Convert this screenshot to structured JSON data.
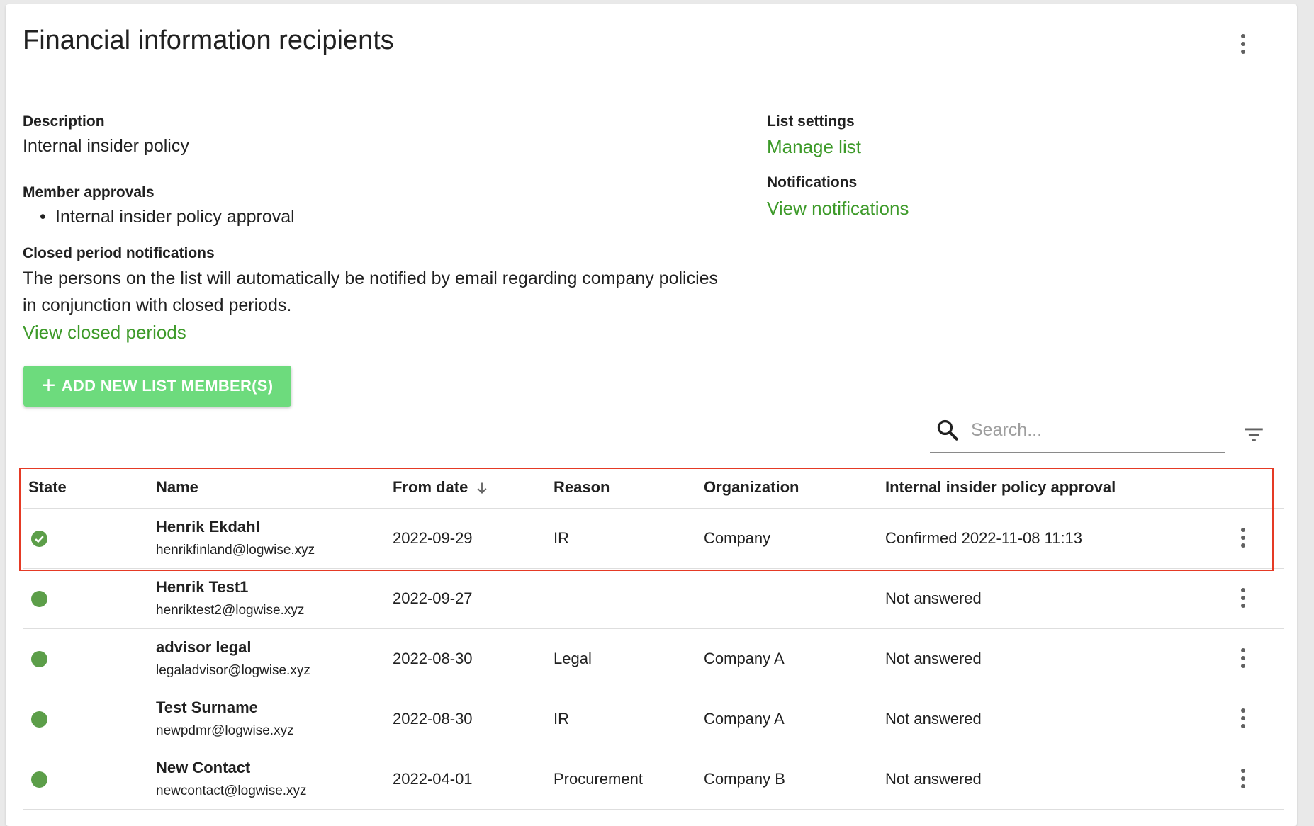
{
  "page": {
    "title": "Financial information recipients"
  },
  "details": {
    "description_label": "Description",
    "description_value": "Internal insider policy",
    "member_approvals_label": "Member approvals",
    "member_approvals": [
      "Internal insider policy approval"
    ],
    "closed_period_label": "Closed period notifications",
    "closed_period_text": "The persons on the list will automatically be notified by email regarding company policies in conjunction with closed periods.",
    "view_closed_periods": "View closed periods",
    "list_settings_label": "List settings",
    "manage_list": "Manage list",
    "notifications_label": "Notifications",
    "view_notifications": "View notifications"
  },
  "actions": {
    "add_member_label": "ADD NEW LIST MEMBER(S)"
  },
  "search": {
    "placeholder": "Search..."
  },
  "table": {
    "headers": {
      "state": "State",
      "name": "Name",
      "from_date": "From date",
      "reason": "Reason",
      "organization": "Organization",
      "approval": "Internal insider policy approval"
    },
    "rows": [
      {
        "state": "confirmed",
        "name": "Henrik Ekdahl",
        "email": "henrikfinland@logwise.xyz",
        "from_date": "2022-09-29",
        "reason": "IR",
        "organization": "Company",
        "approval": "Confirmed 2022-11-08 11:13"
      },
      {
        "state": "active",
        "name": "Henrik Test1",
        "email": "henriktest2@logwise.xyz",
        "from_date": "2022-09-27",
        "reason": "",
        "organization": "",
        "approval": "Not answered"
      },
      {
        "state": "active",
        "name": "advisor legal",
        "email": "legaladvisor@logwise.xyz",
        "from_date": "2022-08-30",
        "reason": "Legal",
        "organization": "Company A",
        "approval": "Not answered"
      },
      {
        "state": "active",
        "name": "Test Surname",
        "email": "newpdmr@logwise.xyz",
        "from_date": "2022-08-30",
        "reason": "IR",
        "organization": "Company A",
        "approval": "Not answered"
      },
      {
        "state": "active",
        "name": "New Contact",
        "email": "newcontact@logwise.xyz",
        "from_date": "2022-04-01",
        "reason": "Procurement",
        "organization": "Company B",
        "approval": "Not answered"
      }
    ]
  },
  "colors": {
    "link_green": "#3d9a29",
    "button_green": "#6ddb7d",
    "state_green": "#5c9e49",
    "highlight_red": "#e53a25"
  }
}
